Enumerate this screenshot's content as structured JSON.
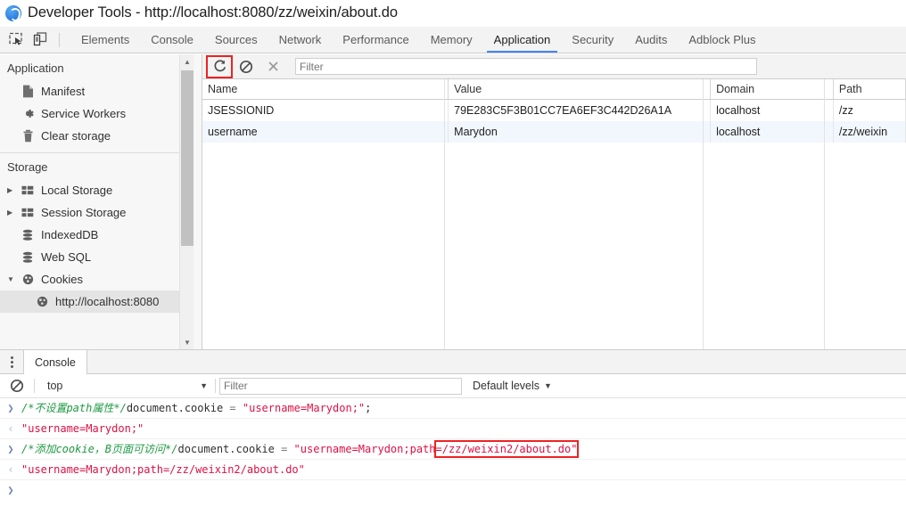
{
  "window": {
    "title": "Developer Tools - http://localhost:8080/zz/weixin/about.do",
    "icon": "chrome-devtools-icon"
  },
  "tabstrip": {
    "inspect_icon": "inspect-element-icon",
    "device_icon": "device-toolbar-icon",
    "tabs": [
      {
        "label": "Elements",
        "active": false
      },
      {
        "label": "Console",
        "active": false
      },
      {
        "label": "Sources",
        "active": false
      },
      {
        "label": "Network",
        "active": false
      },
      {
        "label": "Performance",
        "active": false
      },
      {
        "label": "Memory",
        "active": false
      },
      {
        "label": "Application",
        "active": true
      },
      {
        "label": "Security",
        "active": false
      },
      {
        "label": "Audits",
        "active": false
      },
      {
        "label": "Adblock Plus",
        "active": false
      }
    ],
    "active_underline_color": "#4285f4"
  },
  "sidebar": {
    "sections": [
      {
        "title": "Application",
        "items": [
          {
            "label": "Manifest",
            "icon": "manifest-file-icon",
            "twisty": "",
            "selected": false
          },
          {
            "label": "Service Workers",
            "icon": "gear-icon",
            "twisty": "",
            "selected": false
          },
          {
            "label": "Clear storage",
            "icon": "trash-icon",
            "twisty": "",
            "selected": false
          }
        ]
      },
      {
        "title": "Storage",
        "items": [
          {
            "label": "Local Storage",
            "icon": "table-grid-icon",
            "twisty": "▶",
            "selected": false
          },
          {
            "label": "Session Storage",
            "icon": "table-grid-icon",
            "twisty": "▶",
            "selected": false
          },
          {
            "label": "IndexedDB",
            "icon": "database-icon",
            "twisty": "",
            "selected": false
          },
          {
            "label": "Web SQL",
            "icon": "database-icon",
            "twisty": "",
            "selected": false
          },
          {
            "label": "Cookies",
            "icon": "cookie-icon",
            "twisty": "▼",
            "selected": false
          },
          {
            "label": "http://localhost:8080",
            "icon": "cookie-icon",
            "twisty": "",
            "selected": true,
            "sub": true
          }
        ]
      }
    ],
    "scrollbar": {
      "up_arrow": "▲",
      "down_arrow": "▼"
    }
  },
  "cookies_panel": {
    "toolbar": {
      "refresh_icon": "refresh-icon",
      "refresh_highlighted": true,
      "clear_icon": "clear-all-cookies-icon",
      "delete_icon": "delete-selected-icon",
      "filter_placeholder": "Filter",
      "filter_value": "",
      "highlight_color": "#ee2222"
    },
    "columns": [
      "Name",
      "Value",
      "Domain",
      "Path"
    ],
    "rows": [
      {
        "name": "JSESSIONID",
        "value": "79E283C5F3B01CC7EA6EF3C442D26A1A",
        "domain": "localhost",
        "path": "/zz"
      },
      {
        "name": "username",
        "value": "Marydon",
        "domain": "localhost",
        "path": "/zz/weixin"
      }
    ]
  },
  "console_drawer": {
    "kebab_icon": "more-options-icon",
    "tab_label": "Console",
    "toolbar": {
      "clear_icon": "clear-console-icon",
      "context": "top",
      "context_caret": "▼",
      "filter_placeholder": "Filter",
      "filter_value": "",
      "levels_label": "Default levels",
      "levels_caret": "▼"
    },
    "lines": [
      {
        "type": "input",
        "marker": "❯",
        "segments": [
          {
            "text": "/*不设置path属性*/",
            "style": "comment"
          },
          {
            "text": "document.cookie",
            "style": "plain"
          },
          {
            "text": " = ",
            "style": "op"
          },
          {
            "text": "\"username=Marydon;\"",
            "style": "str"
          },
          {
            "text": ";",
            "style": "plain"
          }
        ]
      },
      {
        "type": "output",
        "marker": "‹",
        "segments": [
          {
            "text": "\"username=Marydon;\"",
            "style": "out"
          }
        ]
      },
      {
        "type": "input",
        "marker": "❯",
        "segments": [
          {
            "text": "/*添加cookie，B页面可访问*/",
            "style": "comment"
          },
          {
            "text": "document.cookie",
            "style": "plain"
          },
          {
            "text": " = ",
            "style": "op"
          },
          {
            "text": "\"username=Marydon;path",
            "style": "str"
          },
          {
            "text": "=/zz/weixin2/about.do\"",
            "style": "str",
            "boxed": true
          }
        ]
      },
      {
        "type": "output",
        "marker": "‹",
        "segments": [
          {
            "text": "\"username=Marydon;path=/zz/weixin2/about.do\"",
            "style": "out"
          }
        ]
      },
      {
        "type": "prompt",
        "marker": "❯",
        "segments": []
      }
    ]
  }
}
